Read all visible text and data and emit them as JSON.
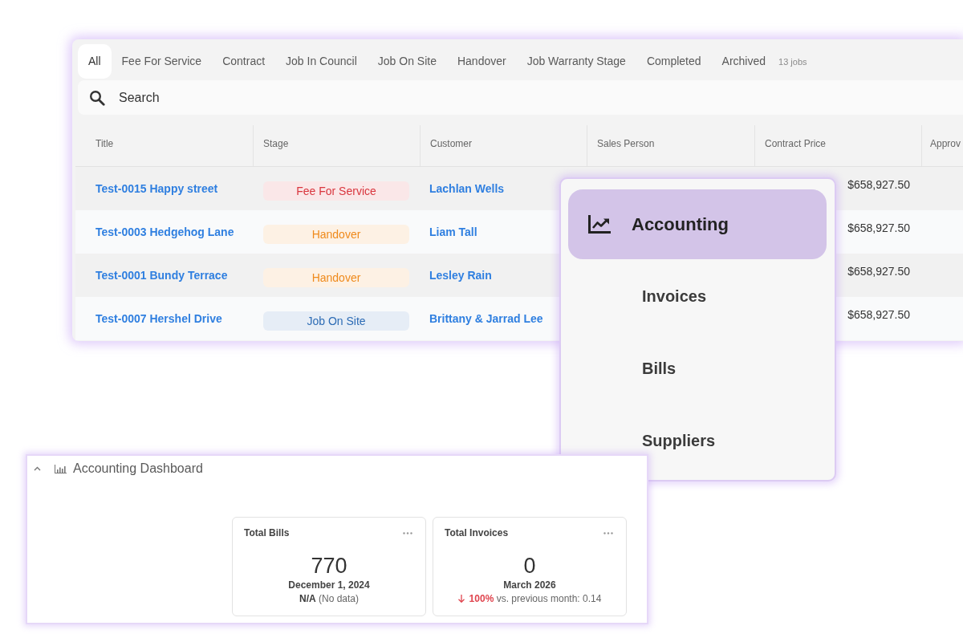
{
  "jobs_panel": {
    "tabs": [
      {
        "label": "All",
        "selected": true
      },
      {
        "label": "Fee For Service",
        "selected": false
      },
      {
        "label": "Contract",
        "selected": false
      },
      {
        "label": "Job In Council",
        "selected": false
      },
      {
        "label": "Job On Site",
        "selected": false
      },
      {
        "label": "Handover",
        "selected": false
      },
      {
        "label": "Job Warranty Stage",
        "selected": false
      },
      {
        "label": "Completed",
        "selected": false
      },
      {
        "label": "Archived",
        "selected": false
      }
    ],
    "job_count": "13 jobs",
    "search": {
      "placeholder": "Search"
    },
    "table": {
      "columns": [
        "Title",
        "Stage",
        "Customer",
        "Sales Person",
        "Contract Price",
        "Approv"
      ],
      "rows": [
        {
          "title": "Test-0015 Happy street",
          "stage": {
            "label": "Fee For Service",
            "color": "#d9363e"
          },
          "customer": "Lachlan Wells",
          "contract_price": "$658,927.50"
        },
        {
          "title": "Test-0003 Hedgehog Lane",
          "stage": {
            "label": "Handover",
            "color": "#ef8a1c"
          },
          "customer": "Liam Tall",
          "contract_price": "$658,927.50"
        },
        {
          "title": "Test-0001 Bundy Terrace",
          "stage": {
            "label": "Handover",
            "color": "#ef8a1c"
          },
          "customer": "Lesley Rain",
          "contract_price": "$658,927.50"
        },
        {
          "title": "Test-0007 Hershel Drive",
          "stage": {
            "label": "Job On Site",
            "color": "#2d6cb5"
          },
          "customer": "Brittany & Jarrad Lee",
          "contract_price": "$658,927.50"
        }
      ]
    }
  },
  "menu": {
    "items": [
      {
        "label": "Accounting",
        "selected": true,
        "children": [
          {
            "label": "Invoices",
            "selected": false
          },
          {
            "label": "Bills",
            "selected": false
          },
          {
            "label": "Suppliers",
            "selected": false
          }
        ]
      }
    ]
  },
  "dashboard": {
    "title": "Accounting Dashboard",
    "expanded": true,
    "cards": [
      {
        "title": "Total Bills",
        "value": "770",
        "period": "December 1, 2024",
        "footer": {
          "kind": "no_data",
          "text": "**N/A** (No data)"
        }
      },
      {
        "title": "Total Invoices",
        "value": "0",
        "period": "March 2026",
        "footer": {
          "kind": "decrease",
          "text": "**100%** vs. previous month: 0.14"
        }
      }
    ]
  }
}
